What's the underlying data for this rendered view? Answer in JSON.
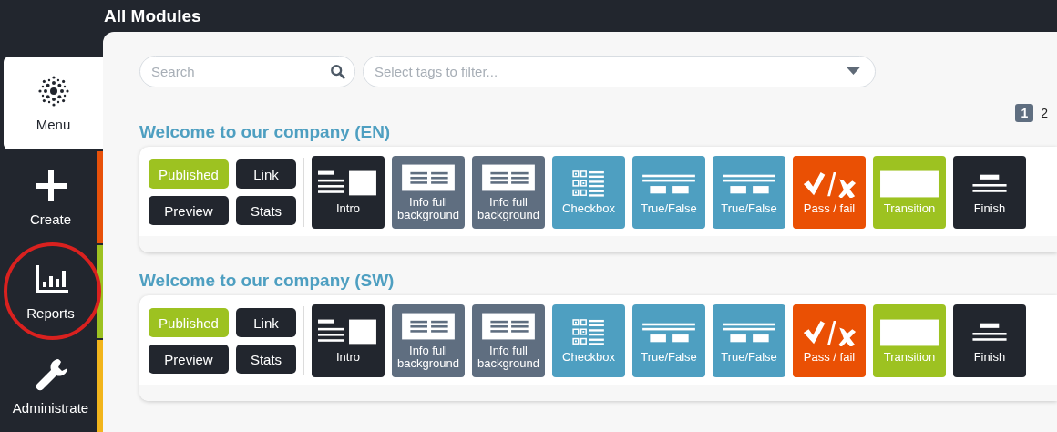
{
  "page_title": "All Modules",
  "sidebar": {
    "items": [
      {
        "label": "Menu",
        "kind": "menu",
        "selected": true,
        "circled": false
      },
      {
        "label": "Create",
        "kind": "create",
        "selected": false,
        "circled": false,
        "color": "#e8510a"
      },
      {
        "label": "Reports",
        "kind": "reports",
        "selected": false,
        "circled": true,
        "color": "#9dc221"
      },
      {
        "label": "Administrate",
        "kind": "administrate",
        "selected": false,
        "circled": false,
        "color": "#f2b51c"
      }
    ]
  },
  "search": {
    "placeholder": "Search"
  },
  "tag_filter": {
    "placeholder": "Select tags to filter..."
  },
  "pagination": [
    {
      "label": "1",
      "selected": true
    },
    {
      "label": "2",
      "selected": false
    }
  ],
  "modules": [
    {
      "title": "Welcome to our company (EN)",
      "status": "Published",
      "actions": [
        "Link",
        "Preview",
        "Stats"
      ],
      "tiles": [
        {
          "label": "Intro",
          "kind": "intro",
          "color": "#22262e"
        },
        {
          "label": "Info full background",
          "kind": "info",
          "color": "#5f6e80"
        },
        {
          "label": "Info full background",
          "kind": "info",
          "color": "#5f6e80"
        },
        {
          "label": "Checkbox",
          "kind": "checkbox",
          "color": "#4e9fc1"
        },
        {
          "label": "True/False",
          "kind": "truefalse",
          "color": "#4e9fc1"
        },
        {
          "label": "True/False",
          "kind": "truefalse",
          "color": "#4e9fc1"
        },
        {
          "label": "Pass / fail",
          "kind": "passfail",
          "color": "#ea5004"
        },
        {
          "label": "Transition",
          "kind": "transition",
          "color": "#9dc221"
        },
        {
          "label": "Finish",
          "kind": "finish",
          "color": "#22262e"
        }
      ]
    },
    {
      "title": "Welcome to our company (SW)",
      "status": "Published",
      "actions": [
        "Link",
        "Preview",
        "Stats"
      ],
      "tiles": [
        {
          "label": "Intro",
          "kind": "intro",
          "color": "#22262e"
        },
        {
          "label": "Info full background",
          "kind": "info",
          "color": "#5f6e80"
        },
        {
          "label": "Info full background",
          "kind": "info",
          "color": "#5f6e80"
        },
        {
          "label": "Checkbox",
          "kind": "checkbox",
          "color": "#4e9fc1"
        },
        {
          "label": "True/False",
          "kind": "truefalse",
          "color": "#4e9fc1"
        },
        {
          "label": "True/False",
          "kind": "truefalse",
          "color": "#4e9fc1"
        },
        {
          "label": "Pass / fail",
          "kind": "passfail",
          "color": "#ea5004"
        },
        {
          "label": "Transition",
          "kind": "transition",
          "color": "#9dc221"
        },
        {
          "label": "Finish",
          "kind": "finish",
          "color": "#22262e"
        }
      ]
    }
  ]
}
